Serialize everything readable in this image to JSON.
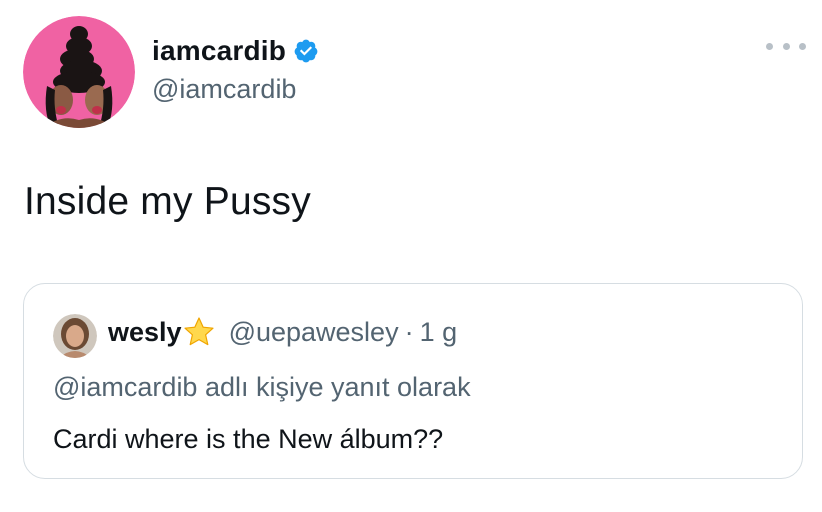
{
  "author": {
    "display_name": "iamcardib",
    "handle": "@iamcardib",
    "verified": true,
    "avatar_icon": "profile-avatar",
    "avatar_bg": "#f062a3"
  },
  "more_icon": "more-options-icon",
  "tweet": {
    "text": "Inside my Pussy"
  },
  "quoted_tweet": {
    "display_name": "wesly",
    "name_emoji": "star-icon",
    "handle": "@uepawesley",
    "separator": "·",
    "time": "1 g",
    "reply_context": "@iamcardib adlı kişiye yanıt olarak",
    "text": "Cardi where is the New álbum??"
  },
  "colors": {
    "verified_blue": "#1d9bf0",
    "secondary_text": "#536471",
    "border": "#d6dde2"
  }
}
